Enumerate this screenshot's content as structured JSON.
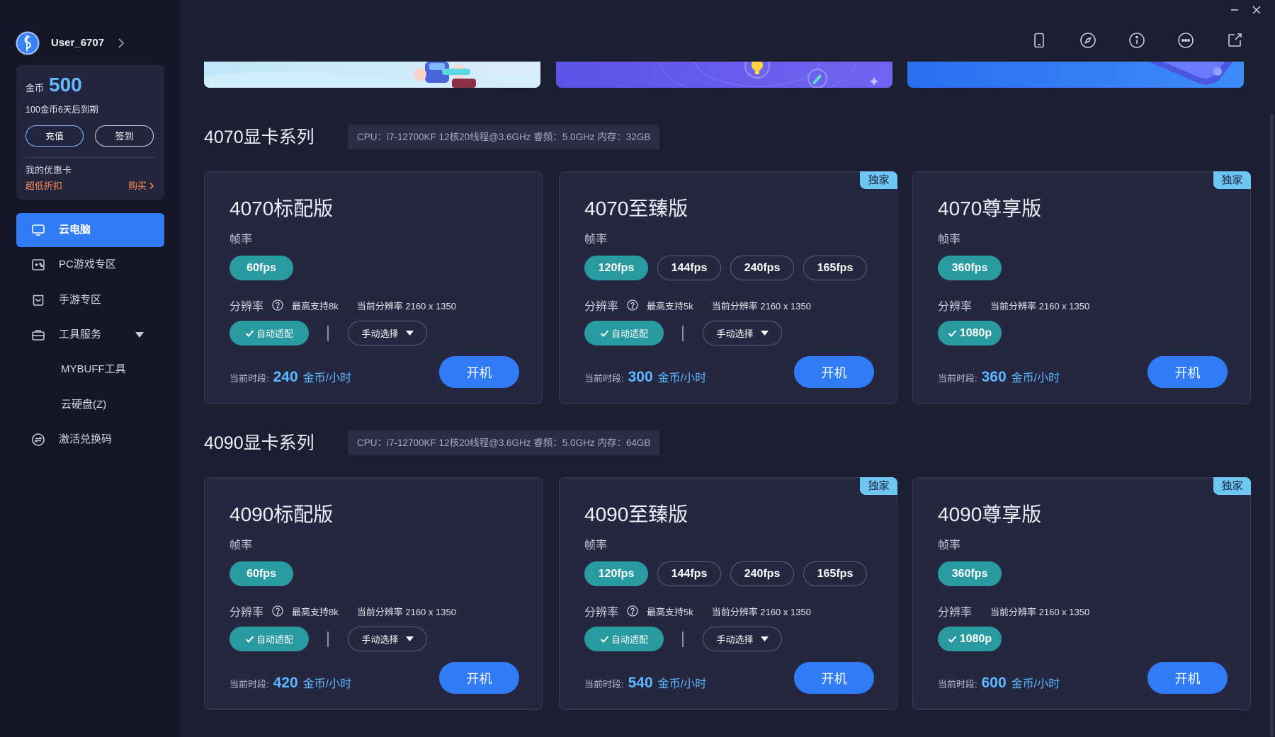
{
  "theme": {
    "accent": "#2f7cf6",
    "teal": "#2a9aa1",
    "price": "#5cb8ff",
    "badge": "#6ec6f3",
    "orange": "#ff8a4f",
    "coin": "#63b8ff"
  },
  "user": {
    "name": "User_6707",
    "avatar_icon": "avatar-icon"
  },
  "wallet": {
    "coin_label": "金币",
    "coins": "500",
    "expiry_note": "100金币6天后到期",
    "recharge_label": "充值",
    "checkin_label": "签到",
    "coupon_title": "我的优惠卡",
    "coupon_subtitle": "超低折扣",
    "buy_label": "购买"
  },
  "nav": {
    "items": [
      {
        "label": "云电脑",
        "icon": "monitor-icon",
        "active": true
      },
      {
        "label": "PC游戏专区",
        "icon": "gamepad-icon"
      },
      {
        "label": "手游专区",
        "icon": "mobile-game-icon"
      },
      {
        "label": "工具服务",
        "icon": "toolbox-icon",
        "expanded": true,
        "children": [
          {
            "label": "MYBUFF工具"
          },
          {
            "label": "云硬盘(Z)"
          }
        ]
      },
      {
        "label": "激活兑换码",
        "icon": "redeem-icon"
      }
    ]
  },
  "toolbar": {
    "icons": [
      "tablet-icon",
      "compass-icon",
      "info-icon",
      "chat-icon",
      "edit-icon"
    ]
  },
  "window_controls": [
    "minimize-icon",
    "close-icon"
  ],
  "labels": {
    "fps": "帧率",
    "resolution": "分辨率",
    "auto": "自动适配",
    "manual": "手动选择",
    "current_period": "当前时段:",
    "unit": "金币/小时",
    "start": "开机",
    "exclusive": "独家"
  },
  "sections": [
    {
      "title": "4070显卡系列",
      "cpu": "CPU：i7-12700KF 12核20线程@3.6GHz 睿频：5.0GHz 内存：32GB",
      "cards": [
        {
          "name": "4070标配版",
          "fps": [
            "60fps"
          ],
          "fps_selected": 0,
          "max_res": "最高支持8k",
          "current_res": "当前分辨率 2160 x 1350",
          "res_mode": "auto",
          "price": "240",
          "exclusive": false
        },
        {
          "name": "4070至臻版",
          "fps": [
            "120fps",
            "144fps",
            "240fps",
            "165fps"
          ],
          "fps_selected": 0,
          "max_res": "最高支持5k",
          "current_res": "当前分辨率 2160 x 1350",
          "res_mode": "auto",
          "price": "300",
          "exclusive": true
        },
        {
          "name": "4070尊享版",
          "fps": [
            "360fps"
          ],
          "fps_selected": 0,
          "current_res": "当前分辨率 2160 x 1350",
          "res_mode": "fixed",
          "res_fixed": "1080p",
          "price": "360",
          "exclusive": true
        }
      ]
    },
    {
      "title": "4090显卡系列",
      "cpu": "CPU：i7-12700KF 12核20线程@3.6GHz 睿频：5.0GHz 内存：64GB",
      "cards": [
        {
          "name": "4090标配版",
          "fps": [
            "60fps"
          ],
          "fps_selected": 0,
          "max_res": "最高支持8k",
          "current_res": "当前分辨率 2160 x 1350",
          "res_mode": "auto",
          "price": "420",
          "exclusive": false
        },
        {
          "name": "4090至臻版",
          "fps": [
            "120fps",
            "144fps",
            "240fps",
            "165fps"
          ],
          "fps_selected": 0,
          "max_res": "最高支持5k",
          "current_res": "当前分辨率 2160 x 1350",
          "res_mode": "auto",
          "price": "540",
          "exclusive": true
        },
        {
          "name": "4090尊享版",
          "fps": [
            "360fps"
          ],
          "fps_selected": 0,
          "current_res": "当前分辨率 2160 x 1350",
          "res_mode": "fixed",
          "res_fixed": "1080p",
          "price": "600",
          "exclusive": true
        }
      ]
    }
  ]
}
